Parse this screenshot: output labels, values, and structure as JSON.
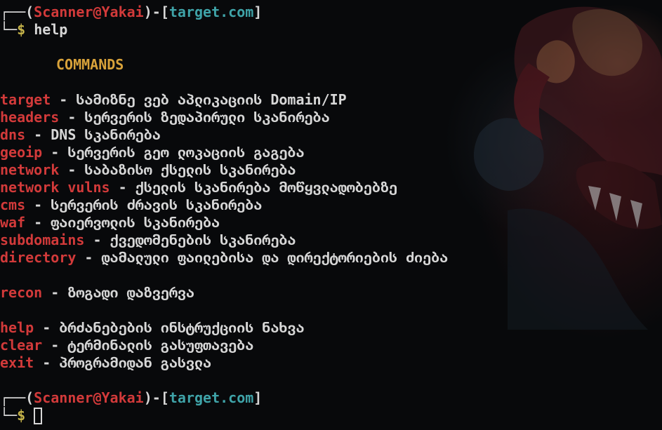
{
  "prompt": {
    "user": "Scanner",
    "at": "@",
    "host": "Yakai",
    "target": "target.com",
    "bracket_top": "┌──",
    "bracket_bottom": "└─",
    "dollar": "$",
    "paren_open": "(",
    "paren_close": ")",
    "dash": "-",
    "sq_open": "[",
    "sq_close": "]"
  },
  "command": "help",
  "heading": "COMMANDS",
  "separator": " - ",
  "commands_group1": [
    {
      "name": "target",
      "desc": "სამიზნე ვებ აპლიკაციის Domain/IP"
    },
    {
      "name": "headers",
      "desc": "სერვერის ზედაპირული სკანირება"
    },
    {
      "name": "dns",
      "desc": "DNS სკანირება"
    },
    {
      "name": "geoip",
      "desc": "სერვერის გეო ლოკაციის გაგება"
    },
    {
      "name": "network",
      "desc": "საბაზისო ქსელის სკანირება"
    },
    {
      "name": "network vulns",
      "desc": "ქსელის სკანირება მოწყვლადობებზე"
    },
    {
      "name": "cms",
      "desc": "სერვერის ძრავის სკანირება"
    },
    {
      "name": "waf",
      "desc": "ფაიერვოლის სკანირება"
    },
    {
      "name": "subdomains",
      "desc": "ქვედომენების სკანირება"
    },
    {
      "name": "directory",
      "desc": "დამალული ფაილებისა და დირექტორიების ძიება"
    }
  ],
  "commands_group2": [
    {
      "name": "recon",
      "desc": "ზოგადი დაზვერვა"
    }
  ],
  "commands_group3": [
    {
      "name": "help",
      "desc": "ბრძანებების ინსტრუქციის ნახვა"
    },
    {
      "name": "clear",
      "desc": "ტერმინალის გასუფთავება"
    },
    {
      "name": "exit",
      "desc": "პროგრამიდან გასვლა"
    }
  ],
  "colors": {
    "background": "#08090b",
    "command_name": "#d23a3a",
    "host": "#d23a3a",
    "target": "#3fa3a8",
    "heading": "#d8a23a",
    "text": "#d7d7d7"
  }
}
